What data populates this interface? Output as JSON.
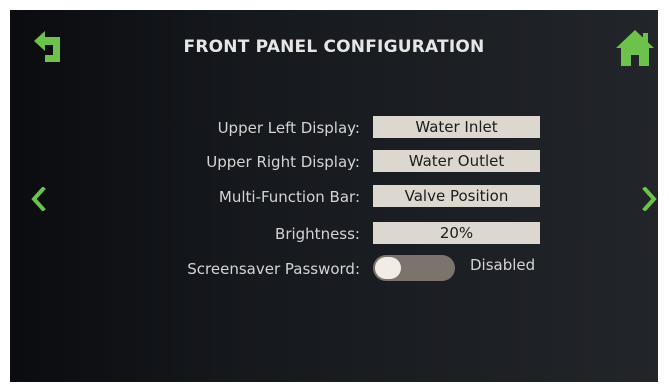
{
  "header": {
    "title": "FRONT PANEL CONFIGURATION",
    "back_icon": "back-arrow-icon",
    "home_icon": "home-icon"
  },
  "nav": {
    "prev_icon": "chevron-left-icon",
    "next_icon": "chevron-right-icon"
  },
  "settings": {
    "upper_left_label": "Upper Left Display:",
    "upper_left_value": "Water Inlet",
    "upper_right_label": "Upper Right Display:",
    "upper_right_value": "Water Outlet",
    "multi_function_label": "Multi-Function Bar:",
    "multi_function_value": "Valve Position",
    "brightness_label": "Brightness:",
    "brightness_value": "20%",
    "screensaver_label": "Screensaver Password:",
    "screensaver_state": "Disabled",
    "screensaver_enabled": false
  },
  "colors": {
    "accent_green": "#6cc24a",
    "value_box": "#ddd8cf",
    "toggle_track": "#7a746c"
  }
}
